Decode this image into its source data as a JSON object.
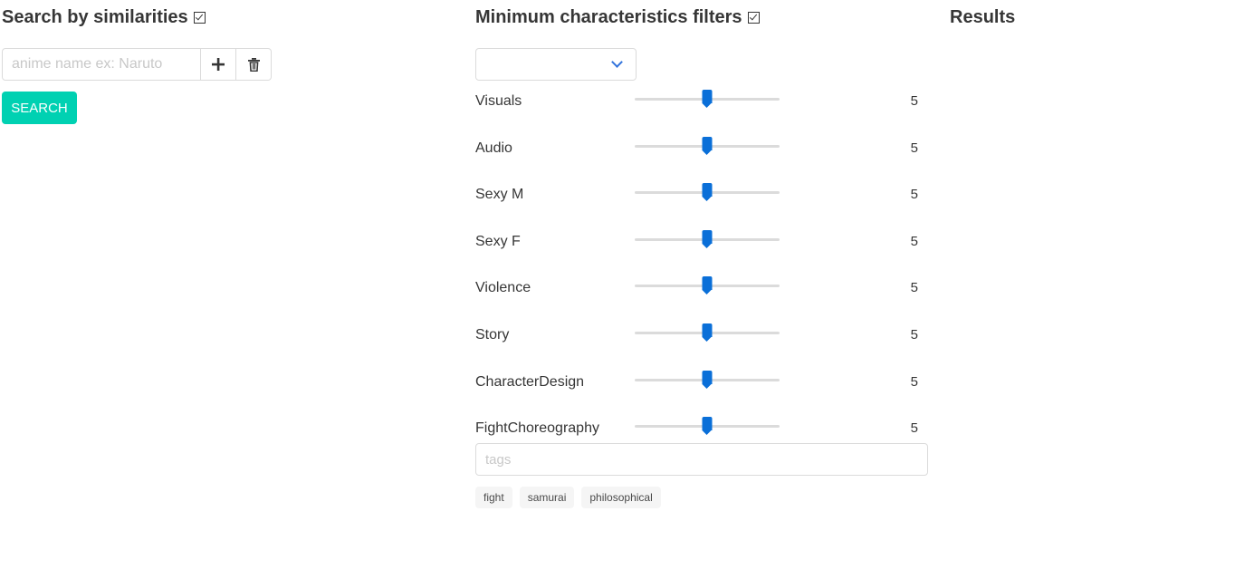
{
  "similarities": {
    "title": "Search by similarities",
    "checkbox_glyph": "☑",
    "input_placeholder": "anime name ex: Naruto",
    "input_value": "",
    "add_icon": "plus-icon",
    "delete_icon": "trash-icon",
    "search_label": "SEARCH"
  },
  "filters": {
    "title": "Minimum characteristics filters",
    "checkbox_glyph": "☑",
    "select_value": "",
    "sliders": [
      {
        "label": "Visuals",
        "value": "5",
        "min": 0,
        "max": 10
      },
      {
        "label": "Audio",
        "value": "5",
        "min": 0,
        "max": 10
      },
      {
        "label": "Sexy M",
        "value": "5",
        "min": 0,
        "max": 10
      },
      {
        "label": "Sexy F",
        "value": "5",
        "min": 0,
        "max": 10
      },
      {
        "label": "Violence",
        "value": "5",
        "min": 0,
        "max": 10
      },
      {
        "label": "Story",
        "value": "5",
        "min": 0,
        "max": 10
      },
      {
        "label": "CharacterDesign",
        "value": "5",
        "min": 0,
        "max": 10
      },
      {
        "label": "FightChoreography",
        "value": "5",
        "min": 0,
        "max": 10
      }
    ],
    "tags_placeholder": "tags",
    "tags": [
      "fight",
      "samurai",
      "philosophical"
    ]
  },
  "results": {
    "title": "Results"
  },
  "colors": {
    "primary_button": "#00d1b2",
    "slider_accent": "#0a6fd8",
    "chevron": "#3273dc"
  }
}
